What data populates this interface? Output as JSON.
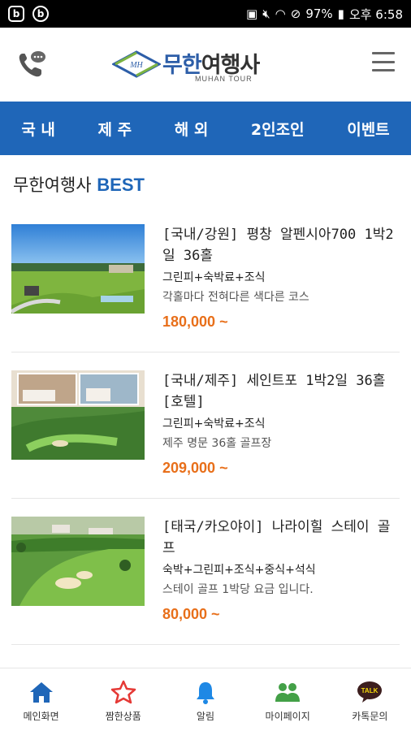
{
  "status_bar": {
    "battery": "97%",
    "time": "오후 6:58",
    "left_apps": [
      "b-app-icon",
      "b-circle-app-icon"
    ]
  },
  "header": {
    "logo_mark": "MH",
    "logo_title_blue": "무한",
    "logo_title_dark": "여행사",
    "logo_subtitle": "MUHAN TOUR"
  },
  "nav": {
    "items": [
      {
        "label": "국 내"
      },
      {
        "label": "제 주"
      },
      {
        "label": "해 외"
      },
      {
        "label": "2인조인"
      },
      {
        "label": "이벤트"
      }
    ]
  },
  "best": {
    "title_prefix": "무한여행사",
    "title_accent": "BEST"
  },
  "products": [
    {
      "title": "[국내/강원] 평창 알펜시아700 1박2일 36홀",
      "tags": "그린피+숙박료+조식",
      "desc": "각홀마다 전혀다른 색다른 코스",
      "price": "180,000 ~"
    },
    {
      "title": "[국내/제주] 세인트포 1박2일 36홀[호텔]",
      "tags": "그린피+숙박료+조식",
      "desc": "제주 명문 36홀 골프장",
      "price": "209,000 ~"
    },
    {
      "title": "[태국/카오야이] 나라이힐 스테이 골프",
      "tags": "숙박+그린피+조식+중식+석식",
      "desc": "스테이 골프 1박당 요금 입니다.",
      "price": "80,000 ~"
    }
  ],
  "tabbar": {
    "items": [
      {
        "label": "메인화면",
        "icon": "home-icon",
        "color": "#1f66b8"
      },
      {
        "label": "짬한상품",
        "icon": "star-icon",
        "color": "#e53935"
      },
      {
        "label": "알림",
        "icon": "bell-icon",
        "color": "#1e88e5"
      },
      {
        "label": "마이페이지",
        "icon": "users-icon",
        "color": "#43a047"
      },
      {
        "label": "카톡문의",
        "icon": "kakaotalk-icon",
        "color": "#3c1e1e"
      }
    ]
  },
  "colors": {
    "brand_blue": "#1f66b8",
    "price_orange": "#e86f1a"
  }
}
